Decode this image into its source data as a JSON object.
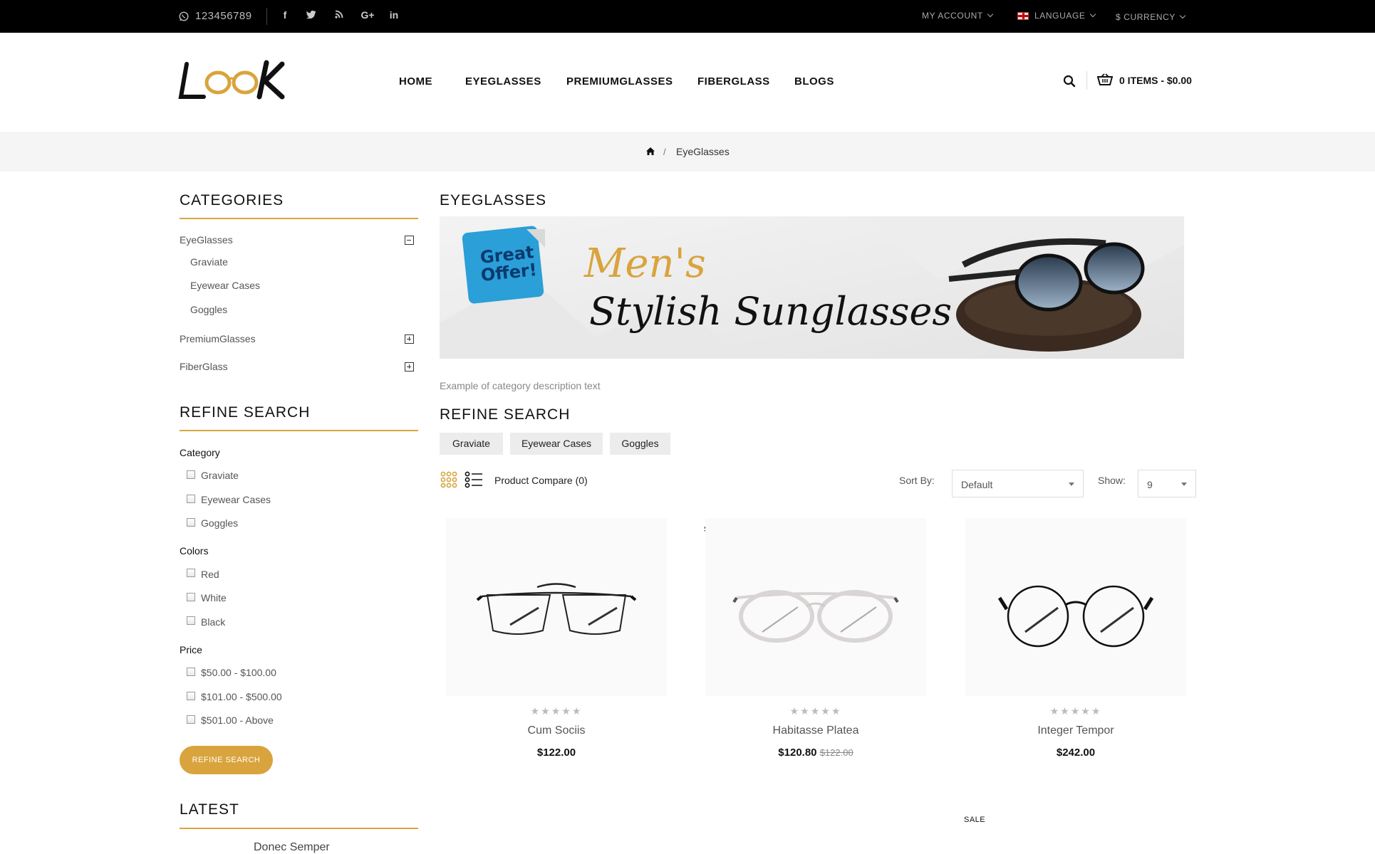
{
  "topbar": {
    "phone": "123456789",
    "social_icons": [
      "facebook-icon",
      "twitter-icon",
      "rss-icon",
      "google-plus-icon",
      "linkedin-icon"
    ],
    "my_account": "My Account",
    "language": "Language",
    "currency": "$ Currency"
  },
  "header": {
    "logo_text": "LOOK",
    "nav": [
      "HOME",
      "EYEGLASSES",
      "PREMIUMGLASSES",
      "FIBERGLASS",
      "BLOGS"
    ],
    "cart": "0 ITEMS - $0.00"
  },
  "breadcrumb": {
    "current": "EyeGlasses",
    "separator": "/"
  },
  "sidebar": {
    "categories_title": "CATEGORIES",
    "categories": [
      {
        "label": "EyeGlasses",
        "expanded": true,
        "children": [
          "Graviate",
          "Eyewear Cases",
          "Goggles"
        ]
      },
      {
        "label": "PremiumGlasses",
        "expanded": false
      },
      {
        "label": "FiberGlass",
        "expanded": false
      }
    ],
    "refine_title": "REFINE SEARCH",
    "filter_groups": [
      {
        "label": "Category",
        "options": [
          "Graviate",
          "Eyewear Cases",
          "Goggles"
        ]
      },
      {
        "label": "Colors",
        "options": [
          "Red",
          "White",
          "Black"
        ]
      },
      {
        "label": "Price",
        "options": [
          "$50.00 - $100.00",
          "$101.00 - $500.00",
          "$501.00 - Above"
        ]
      }
    ],
    "refine_button": "Refine Search",
    "latest_title": "LATEST",
    "latest_item": "Donec Semper"
  },
  "main": {
    "title": "EYEGLASSES",
    "banner": {
      "sticker": "Great Offer!",
      "line1": "Men's",
      "line2": "Stylish Sunglasses"
    },
    "description": "Example of category description text",
    "refine_title": "REFINE SEARCH",
    "refine_tags": [
      "Graviate",
      "Eyewear Cases",
      "Goggles"
    ],
    "compare": "Product Compare (0)",
    "sort_label": "Sort By:",
    "sort_value": "Default",
    "show_label": "Show:",
    "show_value": "9",
    "sale_label": "SALE",
    "products": [
      {
        "name": "Cum Sociis",
        "price": "$122.00",
        "old_price": ""
      },
      {
        "name": "Habitasse Platea",
        "price": "$120.80",
        "old_price": "$122.00"
      },
      {
        "name": "Integer Tempor",
        "price": "$242.00",
        "old_price": ""
      }
    ],
    "stars": "★★★★★"
  },
  "colors": {
    "accent": "#d9a43d",
    "topbar": "#000000",
    "crumbbar": "#f5f5f5"
  }
}
